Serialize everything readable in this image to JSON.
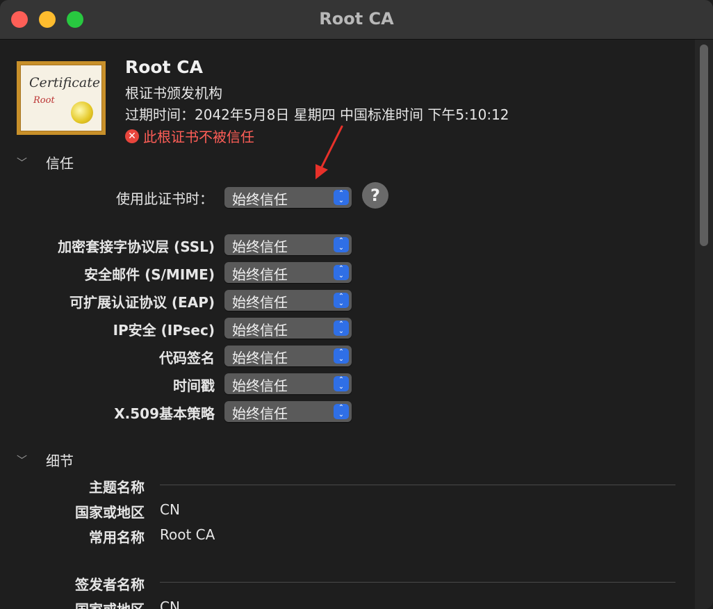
{
  "window": {
    "title": "Root CA"
  },
  "certificate": {
    "icon_text": "Certificate",
    "icon_subtext": "Root",
    "name": "Root CA",
    "kind": "根证书颁发机构",
    "expiry": "过期时间：2042年5月8日 星期四 中国标准时间 下午5:10:12",
    "warning": "此根证书不被信任"
  },
  "trust": {
    "section_label": "信任",
    "when_using_label": "使用此证书时：",
    "when_using_value": "始终信任",
    "help_label": "?",
    "rows": [
      {
        "label": "加密套接字协议层 (SSL)",
        "value": "始终信任"
      },
      {
        "label": "安全邮件 (S/MIME)",
        "value": "始终信任"
      },
      {
        "label": "可扩展认证协议 (EAP)",
        "value": "始终信任"
      },
      {
        "label": "IP安全 (IPsec)",
        "value": "始终信任"
      },
      {
        "label": "代码签名",
        "value": "始终信任"
      },
      {
        "label": "时间戳",
        "value": "始终信任"
      },
      {
        "label": "X.509基本策略",
        "value": "始终信任"
      }
    ]
  },
  "details": {
    "section_label": "细节",
    "subject_label": "主题名称",
    "subject_country_label": "国家或地区",
    "subject_country_value": "CN",
    "subject_common_label": "常用名称",
    "subject_common_value": "Root CA",
    "issuer_label": "签发者名称",
    "issuer_country_label": "国家或地区",
    "issuer_country_value": "CN"
  },
  "colors": {
    "warning": "#ff5e57",
    "annotation_arrow": "#e8312a",
    "popup_accent": "#2f6fe6"
  },
  "icons": [
    "close-light",
    "minimize-light",
    "maximize-light",
    "error-x-icon",
    "chevron-down-icon",
    "popup-stepper-icon",
    "help-icon"
  ]
}
